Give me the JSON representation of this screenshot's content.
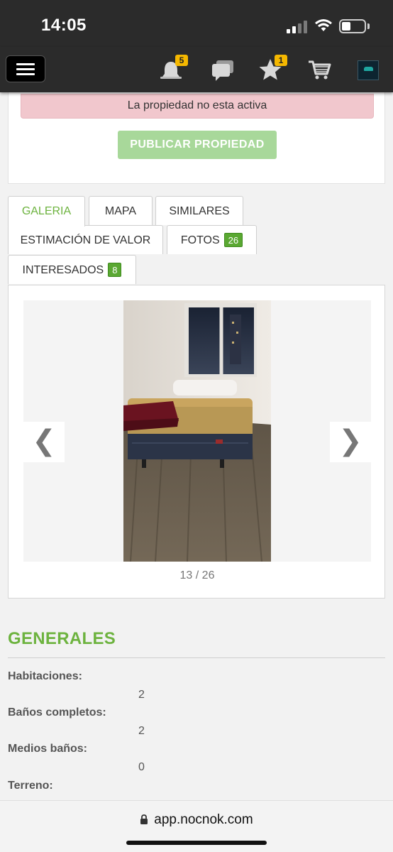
{
  "status_bar": {
    "time": "14:05"
  },
  "header": {
    "notifications_count": "5",
    "favorites_count": "1",
    "icons": [
      "menu-icon",
      "bell-icon",
      "chat-icon",
      "star-icon",
      "cart-icon",
      "avatar"
    ],
    "badge_color": "#f5b800"
  },
  "alert": {
    "text": "La propiedad no esta activa"
  },
  "publish_button": {
    "label": "PUBLICAR PROPIEDAD"
  },
  "tabs": [
    {
      "label": "GALERIA",
      "active": true
    },
    {
      "label": "MAPA"
    },
    {
      "label": "SIMILARES"
    },
    {
      "label": "ESTIMACIÓN DE VALOR"
    },
    {
      "label": "FOTOS",
      "count": "26"
    },
    {
      "label": "INTERESADOS",
      "count": "8"
    }
  ],
  "gallery": {
    "prev": "❮",
    "next": "❯",
    "counter": "13 / 26"
  },
  "generales": {
    "title": "GENERALES",
    "fields": [
      {
        "label": "Habitaciones:",
        "value": "2"
      },
      {
        "label": "Baños completos:",
        "value": "2"
      },
      {
        "label": "Medios baños:",
        "value": "0"
      },
      {
        "label": "Terreno:",
        "value": ""
      }
    ]
  },
  "browser": {
    "url": "app.nocnok.com"
  },
  "colors": {
    "accent_green": "#6db33f",
    "header_bg": "#2b2b2b",
    "alert_bg": "#f1c7cd"
  }
}
